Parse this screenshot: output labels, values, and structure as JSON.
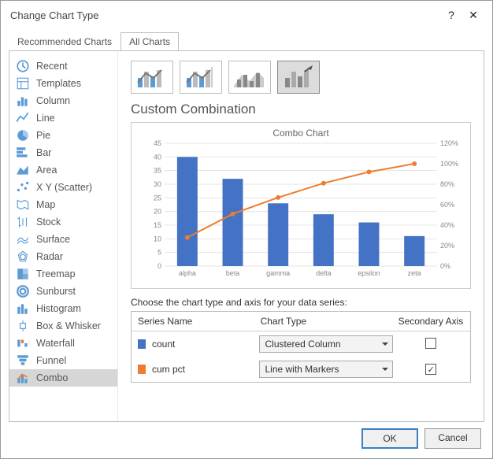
{
  "titlebar": {
    "title": "Change Chart Type"
  },
  "tabs": {
    "recommended": "Recommended Charts",
    "all": "All Charts"
  },
  "sidebar": {
    "items": [
      {
        "label": "Recent"
      },
      {
        "label": "Templates"
      },
      {
        "label": "Column"
      },
      {
        "label": "Line"
      },
      {
        "label": "Pie"
      },
      {
        "label": "Bar"
      },
      {
        "label": "Area"
      },
      {
        "label": "X Y (Scatter)"
      },
      {
        "label": "Map"
      },
      {
        "label": "Stock"
      },
      {
        "label": "Surface"
      },
      {
        "label": "Radar"
      },
      {
        "label": "Treemap"
      },
      {
        "label": "Sunburst"
      },
      {
        "label": "Histogram"
      },
      {
        "label": "Box & Whisker"
      },
      {
        "label": "Waterfall"
      },
      {
        "label": "Funnel"
      },
      {
        "label": "Combo"
      }
    ]
  },
  "main": {
    "heading": "Custom Combination",
    "series_instruction": "Choose the chart type and axis for your data series:",
    "headers": {
      "name": "Series Name",
      "type": "Chart Type",
      "axis": "Secondary Axis"
    },
    "series": [
      {
        "name": "count",
        "type": "Clustered Column",
        "secondary": false,
        "color": "#4472c4"
      },
      {
        "name": "cum pct",
        "type": "Line with Markers",
        "secondary": true,
        "color": "#ed7d31"
      }
    ]
  },
  "footer": {
    "ok": "OK",
    "cancel": "Cancel"
  },
  "chart_data": {
    "type": "combo",
    "title": "Combo Chart",
    "categories": [
      "alpha",
      "beta",
      "gamma",
      "delta",
      "epsilon",
      "zeta"
    ],
    "series": [
      {
        "name": "count",
        "type": "bar",
        "axis": "primary",
        "color": "#4472c4",
        "values": [
          40,
          32,
          23,
          19,
          16,
          11
        ]
      },
      {
        "name": "cum pct",
        "type": "line",
        "axis": "secondary",
        "color": "#ed7d31",
        "values": [
          0.28,
          0.51,
          0.67,
          0.81,
          0.92,
          1.0
        ]
      }
    ],
    "primary_axis": {
      "min": 0,
      "max": 45,
      "step": 5,
      "ticks": [
        0,
        5,
        10,
        15,
        20,
        25,
        30,
        35,
        40,
        45
      ]
    },
    "secondary_axis": {
      "min": 0,
      "max": 1.2,
      "step": 0.2,
      "ticks": [
        "0%",
        "20%",
        "40%",
        "60%",
        "80%",
        "100%",
        "120%"
      ]
    }
  }
}
